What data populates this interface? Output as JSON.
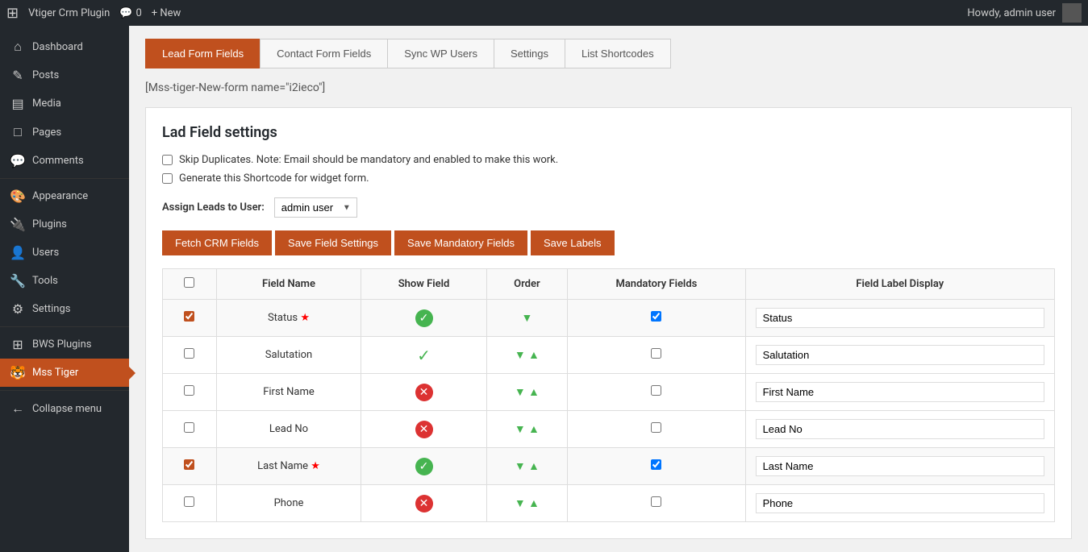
{
  "adminbar": {
    "logo": "⊞",
    "site_name": "Vtiger Crm Plugin",
    "comments_label": "0",
    "new_label": "+ New",
    "howdy": "Howdy, admin user"
  },
  "sidebar": {
    "items": [
      {
        "id": "dashboard",
        "icon": "⌂",
        "label": "Dashboard",
        "active": false
      },
      {
        "id": "posts",
        "icon": "✎",
        "label": "Posts",
        "active": false
      },
      {
        "id": "media",
        "icon": "▤",
        "label": "Media",
        "active": false
      },
      {
        "id": "pages",
        "icon": "□",
        "label": "Pages",
        "active": false
      },
      {
        "id": "comments",
        "icon": "💬",
        "label": "Comments",
        "active": false
      },
      {
        "id": "appearance",
        "icon": "🎨",
        "label": "Appearance",
        "active": false
      },
      {
        "id": "plugins",
        "icon": "🔌",
        "label": "Plugins",
        "active": false
      },
      {
        "id": "users",
        "icon": "👤",
        "label": "Users",
        "active": false
      },
      {
        "id": "tools",
        "icon": "🔧",
        "label": "Tools",
        "active": false
      },
      {
        "id": "settings",
        "icon": "⚙",
        "label": "Settings",
        "active": false
      },
      {
        "id": "bws-plugins",
        "icon": "⊞",
        "label": "BWS Plugins",
        "active": false
      },
      {
        "id": "mss-tiger",
        "icon": "🐯",
        "label": "Mss Tiger",
        "active": true
      },
      {
        "id": "collapse",
        "icon": "←",
        "label": "Collapse menu",
        "active": false
      }
    ]
  },
  "tabs": [
    {
      "id": "lead-form-fields",
      "label": "Lead Form Fields",
      "active": true
    },
    {
      "id": "contact-form-fields",
      "label": "Contact Form Fields",
      "active": false
    },
    {
      "id": "sync-wp-users",
      "label": "Sync WP Users",
      "active": false
    },
    {
      "id": "settings",
      "label": "Settings",
      "active": false
    },
    {
      "id": "list-shortcodes",
      "label": "List Shortcodes",
      "active": false
    }
  ],
  "shortcode": "[Mss-tiger-New-form name=\"i2ieco\"]",
  "settings_box": {
    "title": "Lad Field settings",
    "skip_duplicates_label": "Skip Duplicates. Note: Email should be mandatory and enabled to make this work.",
    "generate_shortcode_label": "Generate this Shortcode for widget form.",
    "assign_leads_label": "Assign Leads to User:",
    "assign_user_value": "admin user",
    "assign_user_options": [
      "admin user"
    ]
  },
  "buttons": {
    "fetch_crm": "Fetch CRM Fields",
    "save_field_settings": "Save Field Settings",
    "save_mandatory_fields": "Save Mandatory Fields",
    "save_labels": "Save Labels"
  },
  "table": {
    "headers": {
      "checkbox": "",
      "field_name": "Field Name",
      "show_field": "Show Field",
      "order": "Order",
      "mandatory_fields": "Mandatory Fields",
      "field_label_display": "Field Label Display"
    },
    "rows": [
      {
        "row_checked": true,
        "field_name": "Status",
        "required": true,
        "show_field": "green-check",
        "order_arrows": "down-only",
        "mandatory": true,
        "label_value": "Status"
      },
      {
        "row_checked": false,
        "field_name": "Salutation",
        "required": false,
        "show_field": "green-tick",
        "order_arrows": "both",
        "mandatory": false,
        "label_value": "Salutation"
      },
      {
        "row_checked": false,
        "field_name": "First Name",
        "required": false,
        "show_field": "red-x",
        "order_arrows": "both",
        "mandatory": false,
        "label_value": "First Name"
      },
      {
        "row_checked": false,
        "field_name": "Lead No",
        "required": false,
        "show_field": "red-x",
        "order_arrows": "both",
        "mandatory": false,
        "label_value": "Lead No"
      },
      {
        "row_checked": true,
        "field_name": "Last Name",
        "required": true,
        "show_field": "green-check",
        "order_arrows": "both",
        "mandatory": true,
        "label_value": "Last Name"
      },
      {
        "row_checked": false,
        "field_name": "Phone",
        "required": false,
        "show_field": "red-x",
        "order_arrows": "both",
        "mandatory": false,
        "label_value": "Phone"
      }
    ]
  }
}
